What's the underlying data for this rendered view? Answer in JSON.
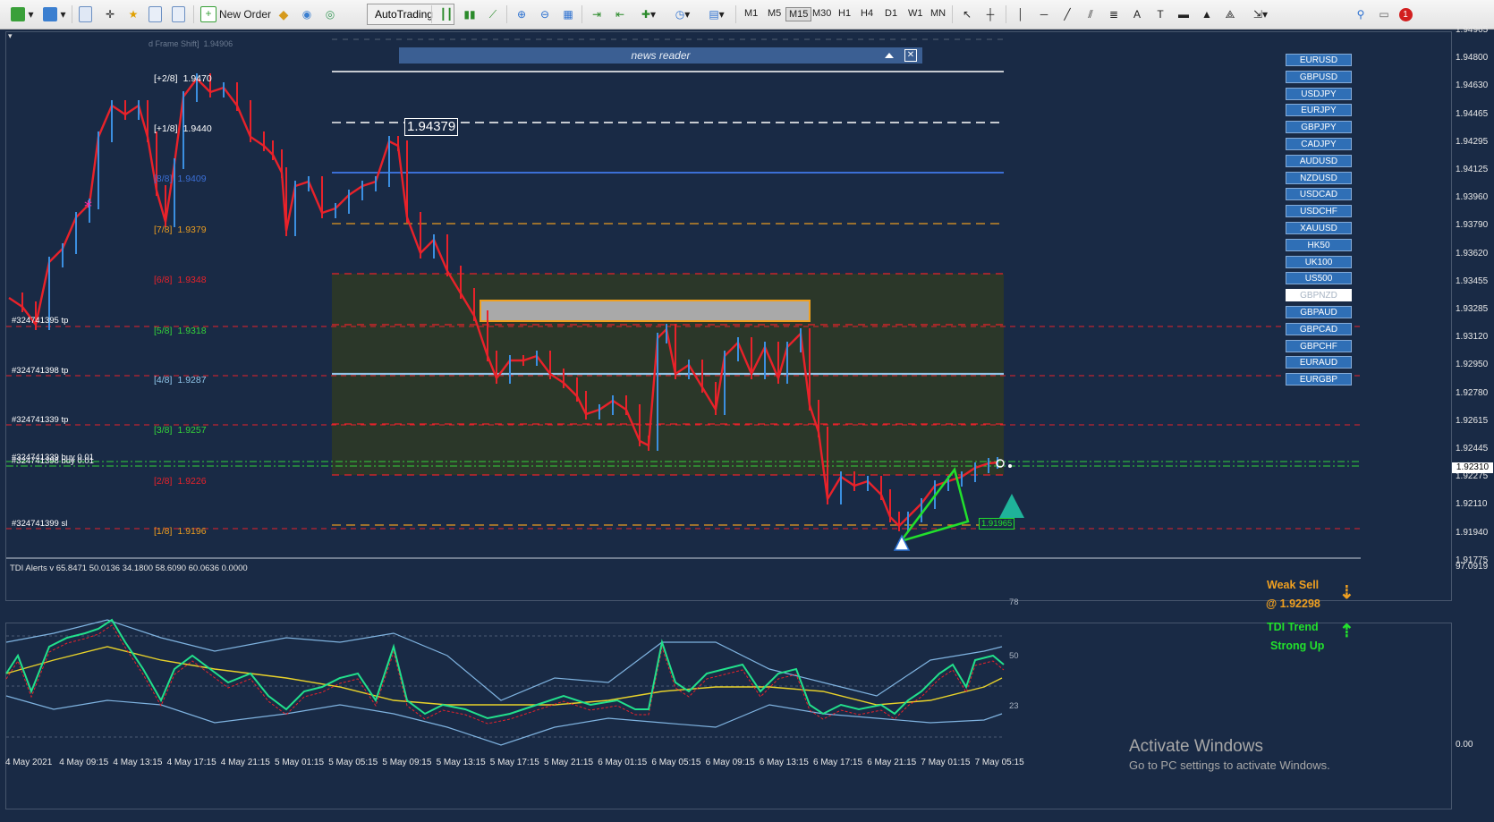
{
  "toolbar": {
    "new_order_label": "New Order",
    "autotrading_label": "AutoTrading",
    "timeframes": [
      "M1",
      "M5",
      "M15",
      "M30",
      "H1",
      "H4",
      "D1",
      "W1",
      "MN"
    ],
    "active_timeframe": "M15",
    "notification_count": "1"
  },
  "chart": {
    "frame_shift_label": "d Frame Shift]",
    "frame_shift_value": "1.94906",
    "price_marker": "1.94379",
    "target_box_label": "1.91965",
    "news_reader": "news reader",
    "murrey_levels": [
      {
        "label": "[+2/8]",
        "price": "1.9470",
        "color": "#ffffff"
      },
      {
        "label": "[+1/8]",
        "price": "1.9440",
        "color": "#ffffff"
      },
      {
        "label": "[8/8]",
        "price": "1.9409",
        "color": "#3b6fd6"
      },
      {
        "label": "[7/8]",
        "price": "1.9379",
        "color": "#e89b20"
      },
      {
        "label": "[6/8]",
        "price": "1.9348",
        "color": "#e8222a"
      },
      {
        "label": "[5/8]",
        "price": "1.9318",
        "color": "#34d13a"
      },
      {
        "label": "[4/8]",
        "price": "1.9287",
        "color": "#8fc4e8"
      },
      {
        "label": "[3/8]",
        "price": "1.9257",
        "color": "#34d13a"
      },
      {
        "label": "[2/8]",
        "price": "1.9226",
        "color": "#e8222a"
      },
      {
        "label": "[1/8]",
        "price": "1.9196",
        "color": "#e89b20"
      }
    ],
    "trade_labels": [
      "#324741395 tp",
      "#324741398 tp",
      "#324741339 tp",
      "#324741339 buy 0.01",
      "#324741398 buy 0.01",
      "#324741399 sl"
    ],
    "price_axis": [
      "1.94965",
      "1.94800",
      "1.94630",
      "1.94465",
      "1.94295",
      "1.94125",
      "1.93960",
      "1.93790",
      "1.93620",
      "1.93455",
      "1.93285",
      "1.93120",
      "1.92950",
      "1.92780",
      "1.92615",
      "1.92445",
      "1.92275",
      "1.92110",
      "1.91940",
      "1.91775"
    ],
    "current_price": "1.92310",
    "time_axis": [
      "4 May 2021",
      "4 May 09:15",
      "4 May 13:15",
      "4 May 17:15",
      "4 May 21:15",
      "5 May 01:15",
      "5 May 05:15",
      "5 May 09:15",
      "5 May 13:15",
      "5 May 17:15",
      "5 May 21:15",
      "6 May 01:15",
      "6 May 05:15",
      "6 May 09:15",
      "6 May 13:15",
      "6 May 17:15",
      "6 May 21:15",
      "7 May 01:15",
      "7 May 05:15"
    ]
  },
  "symbols": [
    "EURUSD",
    "GBPUSD",
    "USDJPY",
    "EURJPY",
    "GBPJPY",
    "CADJPY",
    "AUDUSD",
    "NZDUSD",
    "USDCAD",
    "USDCHF",
    "XAUUSD",
    "HK50",
    "UK100",
    "US500",
    "GBPNZD",
    "GBPAUD",
    "GBPCAD",
    "GBPCHF",
    "EURAUD",
    "EURGBP"
  ],
  "active_symbol": "GBPNZD",
  "indicator": {
    "title": "TDI Alerts v 65.8471 50.0136 34.1800 58.6090 60.0636 0.0000",
    "axis_top": "97.0919",
    "axis_bottom": "0.00",
    "level_78": "78",
    "level_50": "50",
    "level_23": "23",
    "signal_line1": "Weak Sell",
    "signal_line2": "@ 1.92298",
    "trend_line1": "TDI Trend",
    "trend_line2": "Strong Up",
    "sell_color": "#f0a020",
    "trend_color": "#22e02c"
  },
  "watermark": {
    "title": "Activate Windows",
    "subtitle": "Go to PC settings to activate Windows."
  }
}
